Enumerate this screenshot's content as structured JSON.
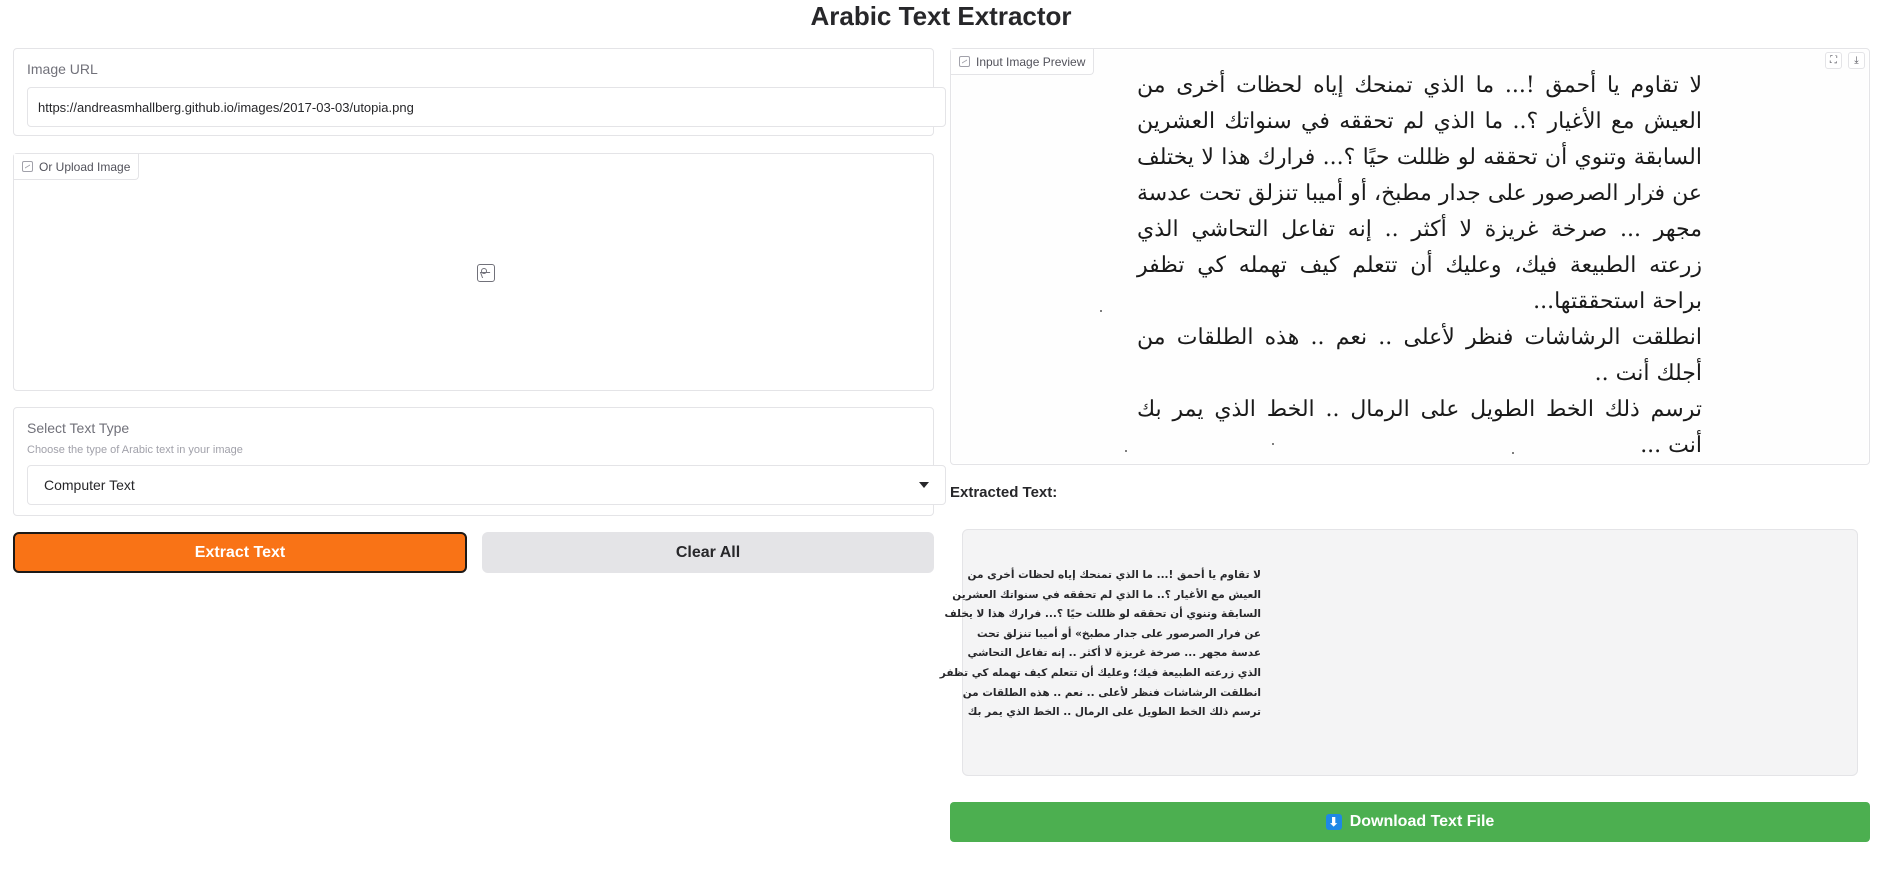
{
  "page": {
    "title": "Arabic Text Extractor"
  },
  "url_block": {
    "label": "Image URL",
    "value": "https://andreasmhallberg.github.io/images/2017-03-03/utopia.png"
  },
  "upload_block": {
    "label": "Or Upload Image",
    "icon": "image-icon"
  },
  "text_type": {
    "label": "Select Text Type",
    "info": "Choose the type of Arabic text in your image",
    "selected": "Computer Text"
  },
  "buttons": {
    "extract": "Extract Text",
    "clear": "Clear All"
  },
  "preview": {
    "label": "Input Image Preview",
    "lines": [
      "لا تقاوم يا أحمق !... ما الذي تمنحك إياه لحظات أخرى من العيش مع الأغيار ؟.. ما الذي لم تحققه في سنواتك العشرين السابقة وتنوي أن تحققه لو ظللت حيًا ؟... فرارك هذا لا يختلف عن فرار الصرصور على جدار مطبخ، أو أميبا تنزلق تحت عدسة مجهر ... صرخة غريزة لا أكثر .. إنه تفاعل التحاشي الذي زرعته الطبيعة فيك، وعليك أن تتعلم كيف تهمله كي تظفر براحة استحققتها...",
      "انطلقت الرشاشات فنظر لأعلى .. نعم .. هذه الطلقات من أجلك أنت ..",
      "ترسم ذلك الخط الطويل على الرمال .. الخط الذي يمر بك أنت ..."
    ]
  },
  "output": {
    "label": "Extracted Text:",
    "text": "لا تقاوم يا أحمق !... ما الذي تمنحك إياه لحظات أخرى من\nالعيش مع الأغيار ؟.. ما الذي لم تحققه في سنواتك العشرين\nالسابقة وتنوي أن تحققه لو ظللت حيًا ؟... فرارك هذا لا يخلف\nعن فرار الصرصور على جدار مطبخ» أو أميبا تنزلق تحت\nعدسة مجهر ... صرخة غريزة لا أكثر .. إنه تفاعل التحاشي\nالذي زرعته الطبيعة فيك؛ وعليك أن تتعلم كيف تهمله كي تظفر\nانطلقت الرشاشات فنظر لأعلى .. نعم .. هذه الطلقات من\nترسم ذلك الخط الطويل على الرمال .. الخط الذي يمر بك"
  },
  "download": {
    "label": "Download Text File",
    "icon": "download-icon"
  }
}
